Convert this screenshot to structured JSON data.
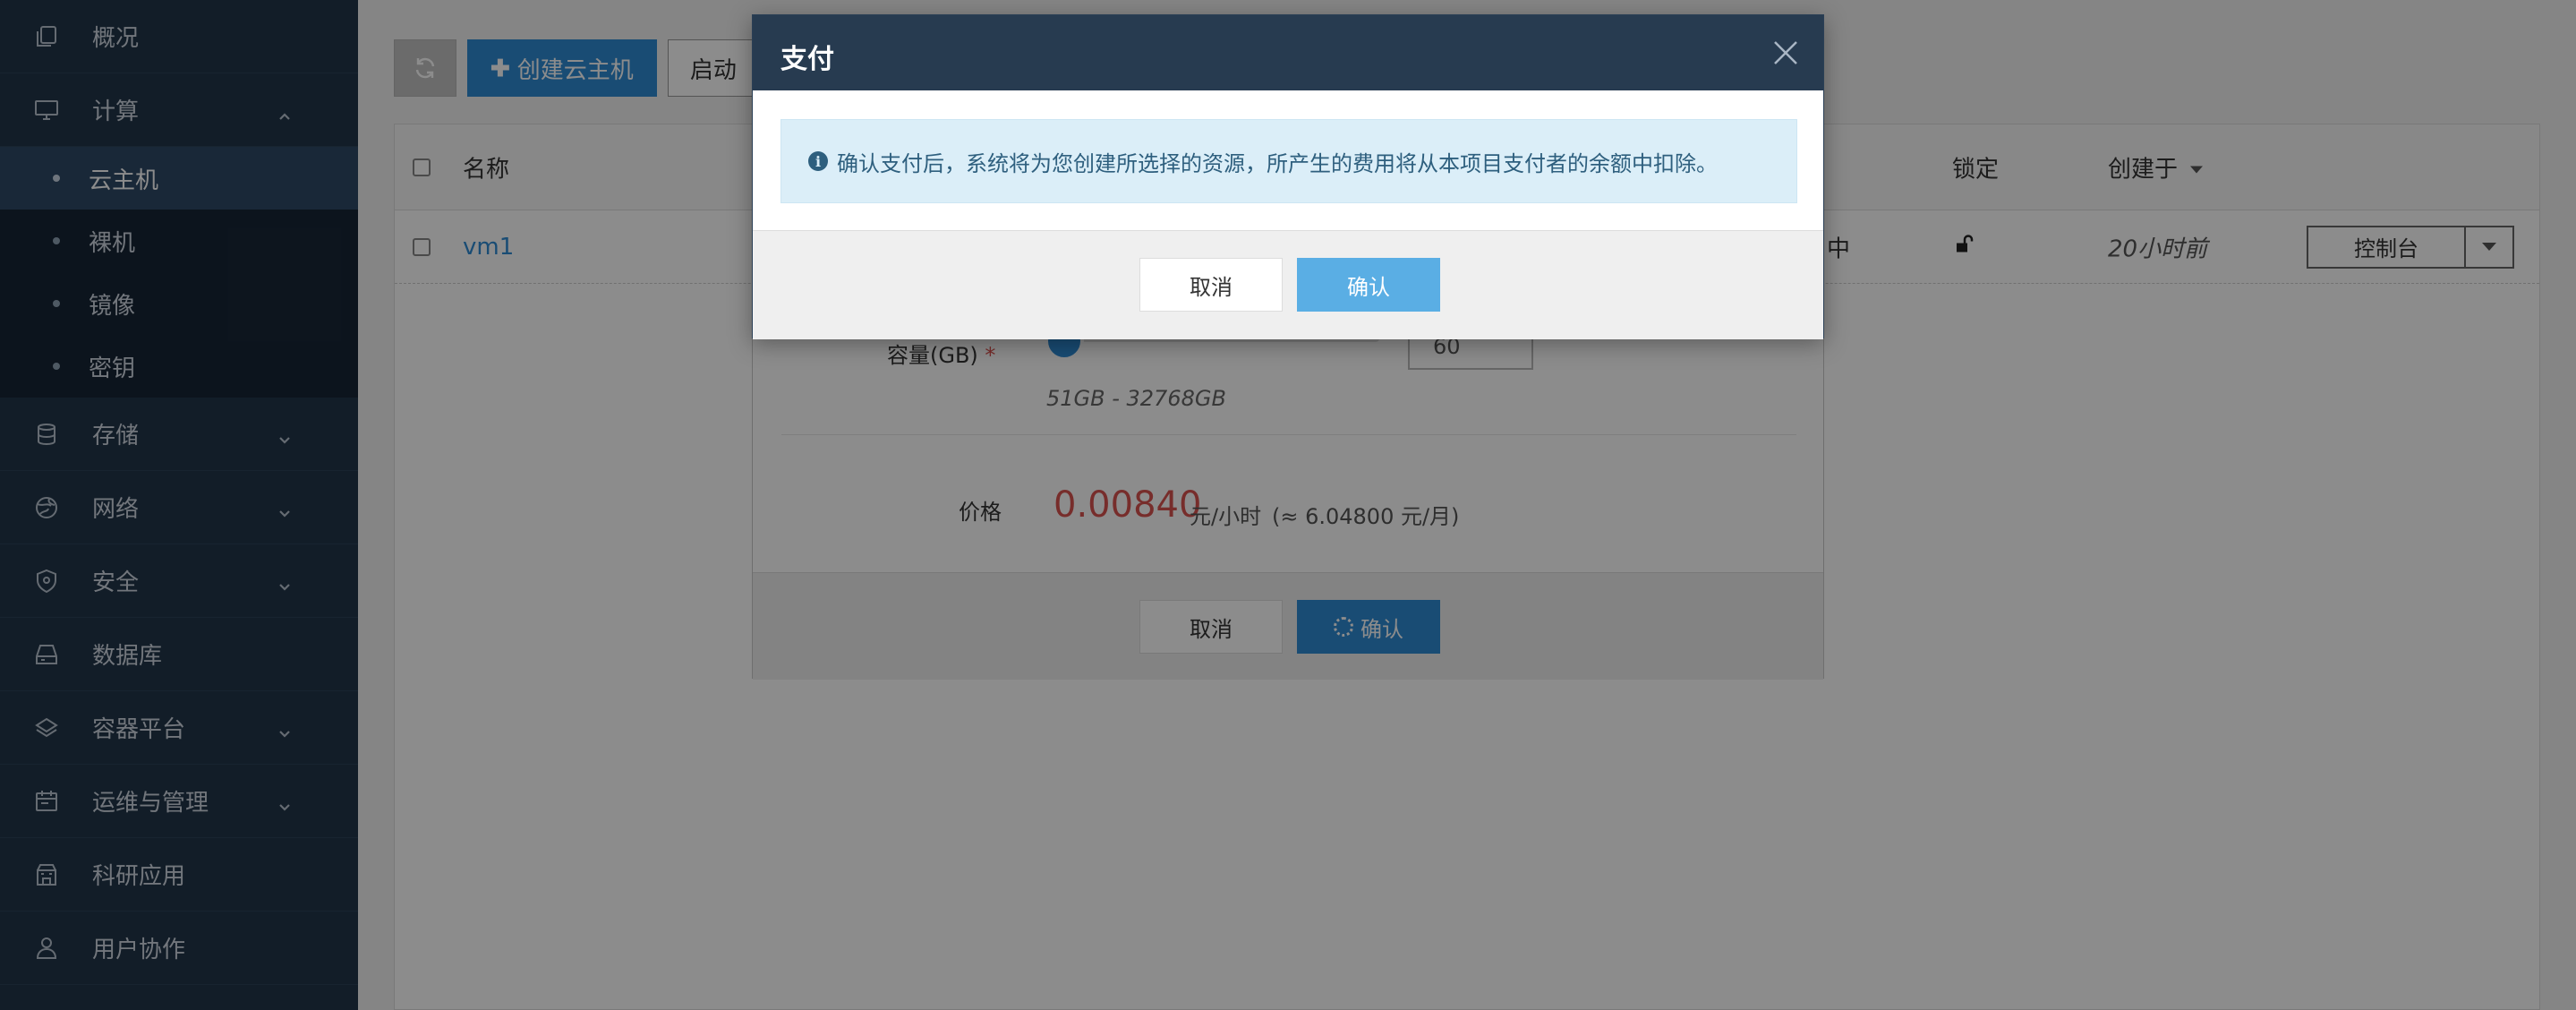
{
  "sidebar": {
    "items": [
      {
        "label": "概况",
        "icon": "copy-icon"
      },
      {
        "label": "计算",
        "icon": "monitor-icon",
        "expanded": true
      },
      {
        "label": "存储",
        "icon": "database-icon"
      },
      {
        "label": "网络",
        "icon": "globe-icon"
      },
      {
        "label": "安全",
        "icon": "shield-icon"
      },
      {
        "label": "数据库",
        "icon": "drive-icon"
      },
      {
        "label": "容器平台",
        "icon": "layers-icon"
      },
      {
        "label": "运维与管理",
        "icon": "calendar-icon"
      },
      {
        "label": "科研应用",
        "icon": "building-icon"
      },
      {
        "label": "用户协作",
        "icon": "users-icon"
      }
    ],
    "compute_sub": [
      {
        "label": "云主机",
        "active": true
      },
      {
        "label": "裸机"
      },
      {
        "label": "镜像"
      },
      {
        "label": "密钥"
      }
    ]
  },
  "toolbar": {
    "create_label": "创建云主机",
    "start_label": "启动"
  },
  "table": {
    "headers": {
      "name": "名称",
      "lock": "锁定",
      "created": "创建于"
    },
    "rows": [
      {
        "name": "vm1",
        "status_tail": "中",
        "created": "20小时前",
        "action": "控制台"
      }
    ]
  },
  "create_modal": {
    "capacity_label": "容量(GB)",
    "capacity_value": "60",
    "capacity_range": "51GB - 32768GB",
    "price_label": "价格",
    "price_value": "0.00840",
    "price_unit": "元/小时",
    "price_month": "(≈ 6.04800 元/月)",
    "cancel_label": "取消",
    "confirm_label": "确认"
  },
  "pay_modal": {
    "title": "支付",
    "message": "确认支付后，系统将为您创建所选择的资源，所产生的费用将从本项目支付者的余额中扣除。",
    "cancel_label": "取消",
    "confirm_label": "确认"
  },
  "colors": {
    "sidebar_bg": "#213549",
    "accent": "#2f8bd4",
    "price": "#d9534f",
    "alert_bg": "#dbeef8"
  }
}
